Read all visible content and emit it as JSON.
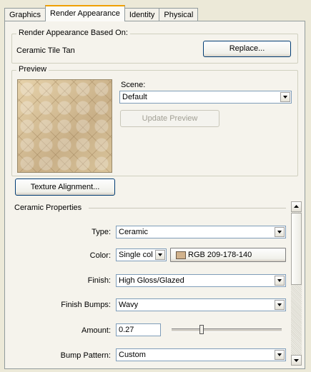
{
  "tabs": [
    {
      "label": "Graphics"
    },
    {
      "label": "Render Appearance"
    },
    {
      "label": "Identity"
    },
    {
      "label": "Physical"
    }
  ],
  "appearance_group": {
    "title": "Render Appearance Based On:",
    "material_name": "Ceramic Tile Tan",
    "replace_label": "Replace..."
  },
  "preview_group": {
    "title": "Preview",
    "scene_label": "Scene:",
    "scene_value": "Default",
    "update_label": "Update Preview"
  },
  "texture_alignment_label": "Texture Alignment...",
  "ceramic": {
    "title": "Ceramic Properties",
    "type_label": "Type:",
    "type_value": "Ceramic",
    "color_label": "Color:",
    "color_mode": "Single col",
    "color_value": "RGB 209-178-140",
    "color_hex": "#d1b28c",
    "finish_label": "Finish:",
    "finish_value": "High Gloss/Glazed",
    "bumps_label": "Finish Bumps:",
    "bumps_value": "Wavy",
    "amount_label": "Amount:",
    "amount_value": "0.27",
    "amount_fraction": 0.27,
    "pattern_label": "Bump Pattern:",
    "pattern_value": "Custom"
  }
}
